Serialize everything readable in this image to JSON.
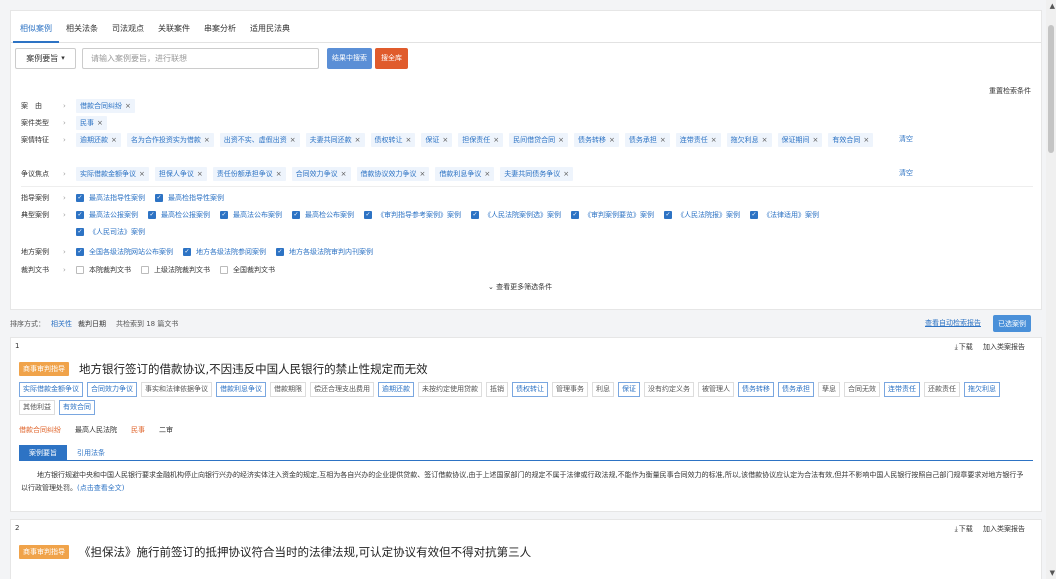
{
  "tabs": [
    "相似案例",
    "相关法条",
    "司法观点",
    "关联案件",
    "串案分析",
    "适用民法典"
  ],
  "search": {
    "select_label": "案例要旨",
    "placeholder": "请输入案例要旨，进行联想",
    "btn_within": "结果中搜索",
    "btn_all": "搜全库"
  },
  "reset_label": "重置检索条件",
  "clear_label": "清空",
  "filters": {
    "cause": {
      "label": "案　由",
      "tags": [
        "借款合同纠纷"
      ]
    },
    "type": {
      "label": "案件类型",
      "tags": [
        "民事"
      ]
    },
    "features": {
      "label": "案情特征",
      "tags": [
        "逾期还款",
        "名为合作投资实为借款",
        "出资不实、虚假出资",
        "夫妻共同还款",
        "债权转让",
        "保证",
        "担保责任",
        "民间借贷合同",
        "债务转移",
        "债务承担",
        "连带责任",
        "拖欠利息",
        "保证期间",
        "有效合同"
      ]
    },
    "focus": {
      "label": "争议焦点",
      "tags": [
        "实际借款金额争议",
        "担保人争议",
        "责任份额承担争议",
        "合同效力争议",
        "借款协议效力争议",
        "借款利息争议",
        "夫妻共同债务争议"
      ]
    },
    "guide": {
      "label": "指导案例",
      "items": [
        "最高法指导性案例",
        "最高检指导性案例"
      ]
    },
    "typical": {
      "label": "典型案例",
      "items": [
        "最高法公报案例",
        "最高检公报案例",
        "最高法公布案例",
        "最高检公布案例",
        "《审判指导参考案例》案例",
        "《人民法院案例选》案例",
        "《审判案例要览》案例",
        "《人民法院报》案例",
        "《法律适用》案例",
        "《人民司法》案例"
      ]
    },
    "local": {
      "label": "地方案例",
      "items": [
        "全国各级法院网站公布案例",
        "地方各级法院参阅案例",
        "地方各级法院审判内刊案例"
      ]
    },
    "docs": {
      "label": "裁判文书",
      "items": [
        "本院裁判文书",
        "上级法院裁判文书",
        "全国裁判文书"
      ]
    }
  },
  "more_label": "查看更多筛选条件",
  "sort": {
    "label": "排序方式：",
    "relevance": "相关性",
    "date": "裁判日期",
    "count": "共检索到 18 篇文书"
  },
  "auto_report": "查看自动检索报告",
  "chosen": "已选案例",
  "cards": [
    {
      "num": "1",
      "badge": "商事审判指导",
      "title": "地方银行签订的借款协议,不因违反中国人民银行的禁止性规定而无效",
      "download": "下载",
      "report": "加入类案报告",
      "keywords": [
        [
          "实际借款金额争议",
          1
        ],
        [
          "合同效力争议",
          1
        ],
        [
          "事实和法律依据争议",
          0
        ],
        [
          "借款利息争议",
          1
        ],
        [
          "借款期限",
          0
        ],
        [
          "偿还合理支出费用",
          0
        ],
        [
          "逾期还款",
          1
        ],
        [
          "未按约定使用贷款",
          0
        ],
        [
          "抵销",
          0
        ],
        [
          "债权转让",
          1
        ],
        [
          "管理事务",
          0
        ],
        [
          "利息",
          0
        ],
        [
          "保证",
          1
        ],
        [
          "没有约定义务",
          0
        ],
        [
          "被管理人",
          0
        ],
        [
          "债务转移",
          1
        ],
        [
          "债务承担",
          1
        ],
        [
          "孳息",
          0
        ],
        [
          "合同无效",
          0
        ],
        [
          "连带责任",
          1
        ],
        [
          "还款责任",
          0
        ],
        [
          "拖欠利息",
          1
        ],
        [
          "其他利益",
          0
        ],
        [
          "有效合同",
          1
        ]
      ],
      "meta": [
        "借款合同纠纷",
        "最高人民法院",
        "民事",
        "二审"
      ],
      "subtabs": [
        "案例要旨",
        "引用法条"
      ],
      "abstract": "地方银行规避中央和中国人民银行要求金融机构停止向银行兴办的经济实体注入资金的规定,互相为各自兴办的企业提供贷款、签订借款协议,由于上述国家部门的规定不属于法律或行政法规,不能作为衡量民事合同效力的标准,所以,该借款协议应认定为合法有效,但并不影响中国人民银行按照自己部门规章要求对地方银行予以行政管理处罚。",
      "more": "(点击查看全文)"
    },
    {
      "num": "2",
      "badge": "商事审判指导",
      "title": "《担保法》施行前签订的抵押协议符合当时的法律法规,可认定协议有效但不得对抗第三人",
      "download": "下载",
      "report": "加入类案报告"
    }
  ]
}
